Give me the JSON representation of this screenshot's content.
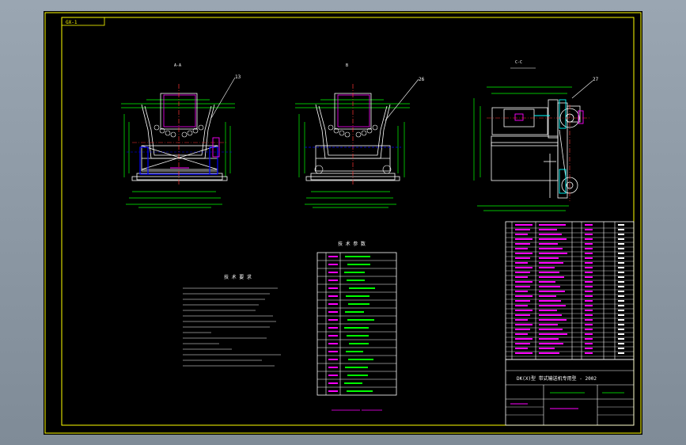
{
  "drawing": {
    "corner_tag": "GX-1",
    "views": [
      {
        "label": "A-A",
        "callout": "13"
      },
      {
        "label": "B",
        "callout": "26"
      },
      {
        "label": "C-C",
        "callout": "27"
      }
    ],
    "tech_requirements_title": "技 术 要 求",
    "tech_params_title": "技 术 参 数",
    "scale_title": "",
    "title_block_name": "DK(X)型  带式输送机专用型 - 2002"
  },
  "colors": {
    "frame": "#ffff00",
    "outline": "#ffffff",
    "dimension": "#00ff00",
    "center": "#ff3333",
    "hidden": "#0000ff",
    "magenta": "#ff00ff",
    "cyan": "#00ffff"
  }
}
